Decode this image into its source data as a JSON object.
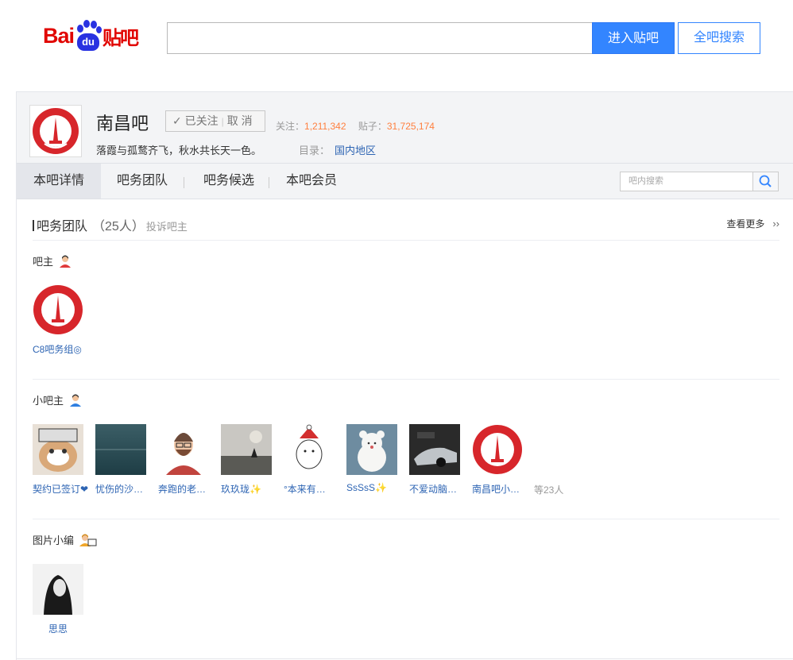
{
  "header": {
    "logo": {
      "bai": "Bai",
      "du": "du",
      "tieba": "贴吧"
    },
    "search_placeholder": "",
    "enter_button": "进入贴吧",
    "all_search_button": "全吧搜索"
  },
  "forum": {
    "name": "南昌吧",
    "follow": {
      "followed": "已关注",
      "cancel": "取 消"
    },
    "stats": {
      "follow_label": "关注：",
      "follow_count": "1,211,342",
      "posts_label": "贴子：",
      "posts_count": "31,725,174"
    },
    "slogan": "落霞与孤鹜齐飞，秋水共长天一色。",
    "catalog_label": "目录：",
    "catalog_value": "国内地区"
  },
  "tabs": [
    "本吧详情",
    "吧务团队",
    "吧务候选",
    "本吧会员"
  ],
  "inner_search_placeholder": "吧内搜索",
  "team": {
    "title": "吧务团队",
    "count": "（25人）",
    "complain": "投诉吧主",
    "see_more": "查看更多",
    "see_more_arrow": "››",
    "owner_label": "吧主",
    "owners": [
      {
        "name": "C8吧务组◎"
      }
    ],
    "small_owner_label": "小吧主",
    "small_owners": [
      {
        "name": "契约已签订❤"
      },
      {
        "name": "忧伤的沙…"
      },
      {
        "name": "奔跑的老…"
      },
      {
        "name": "玖玖珑✨"
      },
      {
        "name": "°本来有…"
      },
      {
        "name": "SsSsS✨"
      },
      {
        "name": "不爱动脑…"
      },
      {
        "name": "南昌吧小…"
      }
    ],
    "small_more": "等23人",
    "editor_label": "图片小编",
    "editors": [
      {
        "name": "思思"
      }
    ]
  },
  "colors": {
    "accent": "#3385ff",
    "link": "#2d64b3",
    "orange": "#ff7f3e",
    "brand_red": "#e10602"
  }
}
